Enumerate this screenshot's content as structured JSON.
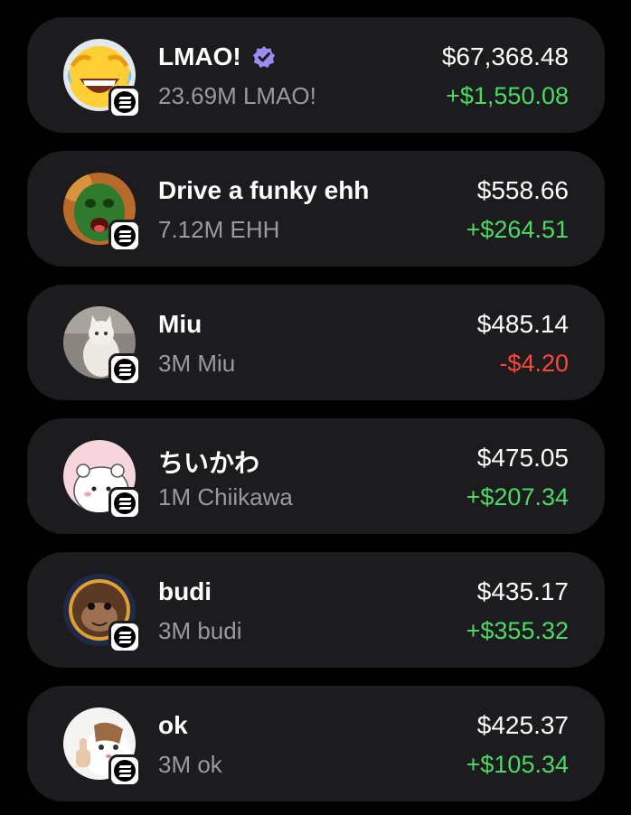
{
  "tokens": [
    {
      "name": "LMAO!",
      "verified": true,
      "amount": "23.69M LMAO!",
      "value": "$67,368.48",
      "change": "+$1,550.08",
      "direction": "up",
      "avatar_icon": "laughing-emoji-icon"
    },
    {
      "name": "Drive a funky ehh",
      "verified": false,
      "amount": "7.12M EHH",
      "value": "$558.66",
      "change": "+$264.51",
      "direction": "up",
      "avatar_icon": "green-face-icon"
    },
    {
      "name": "Miu",
      "verified": false,
      "amount": "3M Miu",
      "value": "$485.14",
      "change": "-$4.20",
      "direction": "down",
      "avatar_icon": "cat-photo-icon"
    },
    {
      "name": "ちいかわ",
      "verified": false,
      "amount": "1M Chiikawa",
      "value": "$475.05",
      "change": "+$207.34",
      "direction": "up",
      "avatar_icon": "chiikawa-character-icon"
    },
    {
      "name": "budi",
      "verified": false,
      "amount": "3M budi",
      "value": "$435.17",
      "change": "+$355.32",
      "direction": "up",
      "avatar_icon": "monkey-face-icon"
    },
    {
      "name": "ok",
      "verified": false,
      "amount": "3M ok",
      "value": "$425.37",
      "change": "+$105.34",
      "direction": "up",
      "avatar_icon": "thumbs-up-cat-icon"
    }
  ],
  "chain_badge_icon": "solana-icon",
  "colors": {
    "background": "#000000",
    "card": "#1c1c1e",
    "positive": "#4cd964",
    "negative": "#ff453a",
    "verified": "#9b8cf5"
  }
}
